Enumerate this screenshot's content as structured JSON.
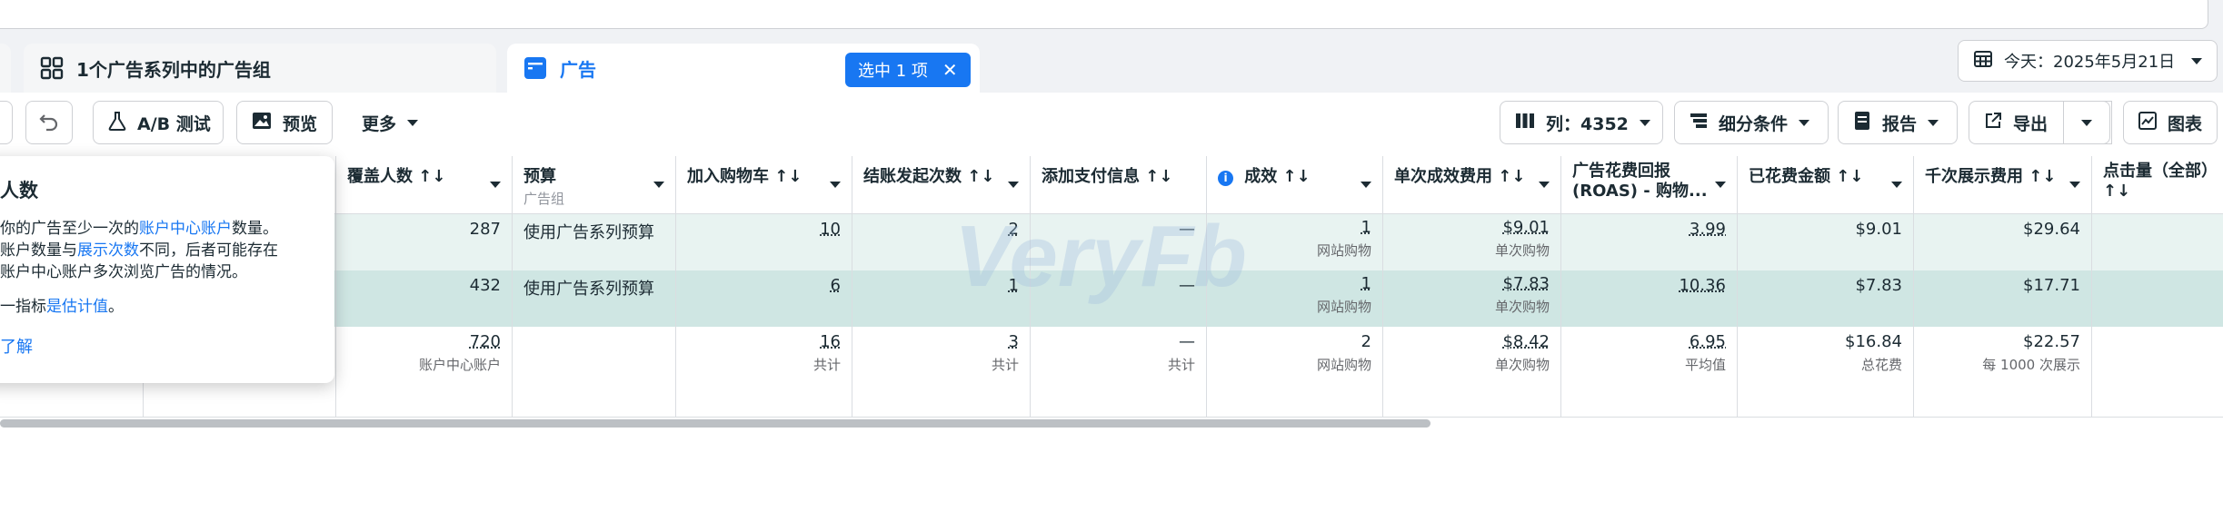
{
  "tabs": {
    "adsets_tab": "1个广告系列中的广告组",
    "ads_tab": "广告",
    "selected_badge": "选中 1 项"
  },
  "date_button": "今天：2025年5月21日",
  "toolbar": {
    "ab_test": "A/B 测试",
    "preview": "预览",
    "more": "更多",
    "columns": "列：4352",
    "breakdown": "细分条件",
    "report": "报告",
    "export": "导出",
    "chart": "图表"
  },
  "headers": [
    {
      "label": "覆盖人数 ↑↓",
      "sub": ""
    },
    {
      "label": "预算",
      "sub": "广告组"
    },
    {
      "label": "加入购物车 ↑↓",
      "sub": ""
    },
    {
      "label": "结账发起次数 ↑↓",
      "sub": ""
    },
    {
      "label": "添加支付信息 ↑↓",
      "sub": ""
    },
    {
      "label": "成效 ↑↓",
      "sub": ""
    },
    {
      "label": "单次成效费用 ↑↓",
      "sub": ""
    },
    {
      "label": "广告花费回报 (ROAS) - 购物...",
      "sub": ""
    },
    {
      "label": "已花费金额 ↑↓",
      "sub": ""
    },
    {
      "label": "千次展示费用 ↑↓",
      "sub": ""
    },
    {
      "label": "点击量（全部） ↑↓",
      "sub": ""
    }
  ],
  "rows": [
    {
      "reach": "287",
      "budget": "使用广告系列预算",
      "add_to_cart": "10",
      "checkout": "2",
      "payment": "—",
      "results": "1",
      "results_sub": "网站购物",
      "cpr": "$9.01",
      "cpr_sub": "单次购物",
      "roas": "3.99",
      "spent": "$9.01",
      "cpm": "$29.64",
      "clicks": ""
    },
    {
      "reach": "432",
      "budget": "使用广告系列预算",
      "add_to_cart": "6",
      "checkout": "1",
      "payment": "—",
      "results": "1",
      "results_sub": "网站购物",
      "cpr": "$7.83",
      "cpr_sub": "单次购物",
      "roas": "10.36",
      "spent": "$7.83",
      "cpm": "$17.71",
      "clicks": ""
    }
  ],
  "totals": {
    "reach": "720",
    "reach_sub": "账户中心账户",
    "add_to_cart": "16",
    "add_to_cart_sub": "共计",
    "checkout": "3",
    "checkout_sub": "共计",
    "payment": "—",
    "payment_sub": "共计",
    "results": "2",
    "results_sub": "网站购物",
    "cpr": "$8.42",
    "cpr_sub": "单次购物",
    "roas": "6.95",
    "roas_sub": "平均值",
    "spent": "$16.84",
    "spent_sub": "总花费",
    "cpm": "$22.57",
    "cpm_sub": "每 1000 次展示"
  },
  "popover": {
    "title": "人数",
    "line1a": "你的广告至少一次的",
    "line1link": "账户中心账户",
    "line1b": "数量。",
    "line2a": "账户数量与",
    "line2link": "展示次数",
    "line2b": "不同，后者可能存在",
    "line3": "账户中心账户多次浏览广告的情况。",
    "line4a": "一指标",
    "line4link": "是估计值",
    "line4b": "。",
    "learn": "了解"
  },
  "watermark": "VeryFb",
  "colors": {
    "accent": "#1877f2",
    "row1_bg": "#e8f3f1",
    "row2_bg": "#cfe6e3"
  }
}
